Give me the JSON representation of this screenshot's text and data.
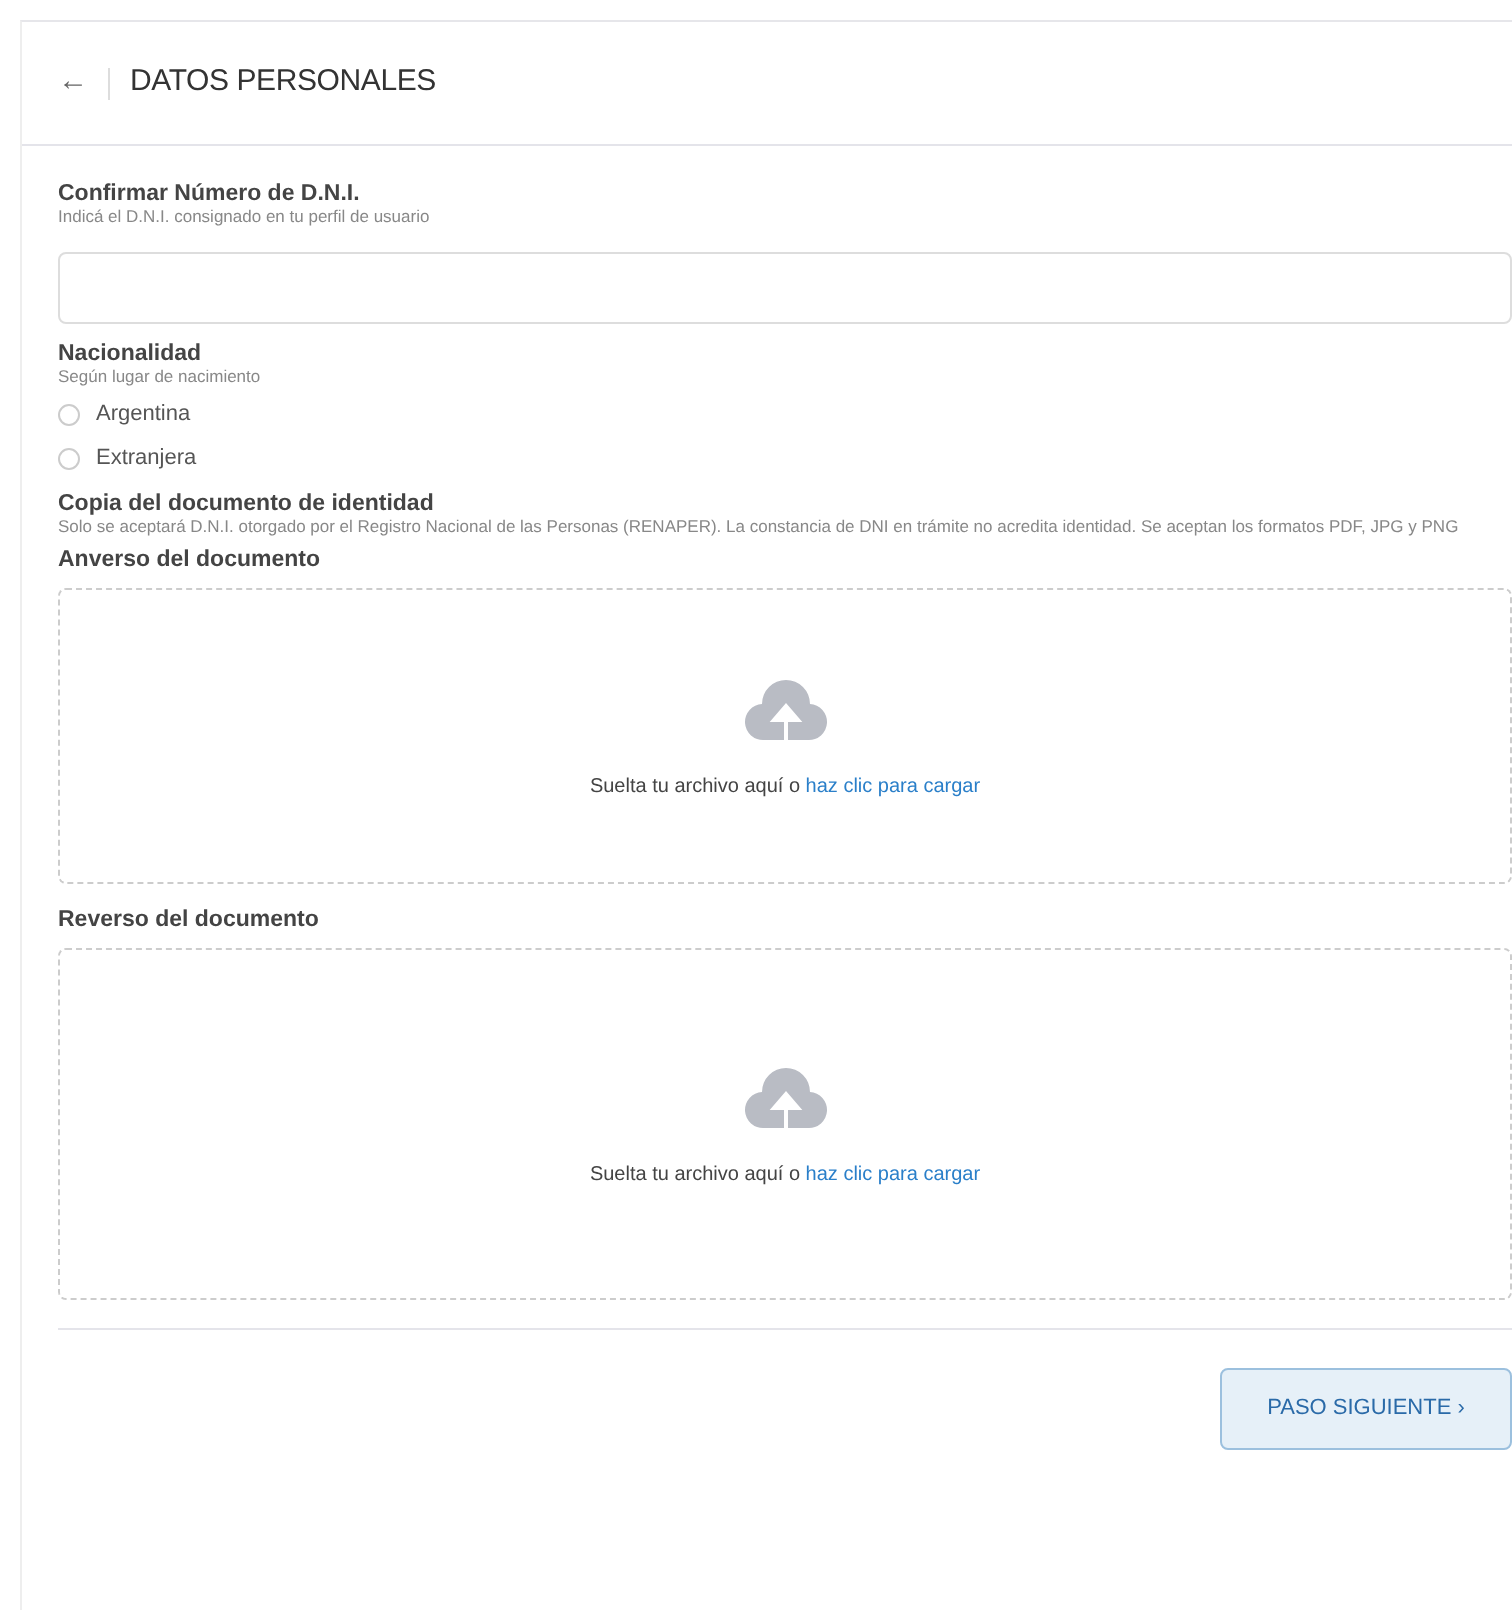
{
  "header": {
    "back": "←",
    "title": "DATOS PERSONALES"
  },
  "dni": {
    "label": "Confirmar Número de D.N.I.",
    "hint": "Indicá el D.N.I. consignado en tu perfil de usuario"
  },
  "nationality": {
    "label": "Nacionalidad",
    "hint": "Según lugar de nacimiento",
    "options": [
      {
        "label": "Argentina",
        "selected": false
      },
      {
        "label": "Extranjera",
        "selected": false
      }
    ]
  },
  "document": {
    "label": "Copia del documento de identidad",
    "hint": "Solo se aceptará D.N.I. otorgado por el Registro Nacional de las Personas (RENAPER). La constancia de DNI en trámite no acredita identidad. Se aceptan los formatos PDF, JPG y PNG",
    "uploads": [
      {
        "label": "Anverso del documento",
        "prompt": "Suelta tu archivo aquí o",
        "link": "haz clic para cargar"
      },
      {
        "label": "Reverso del documento",
        "prompt": "Suelta tu archivo aquí o",
        "link": "haz clic para cargar"
      }
    ]
  },
  "next_button": {
    "label": "PASO SIGUIENTE",
    "chevron": "›"
  }
}
